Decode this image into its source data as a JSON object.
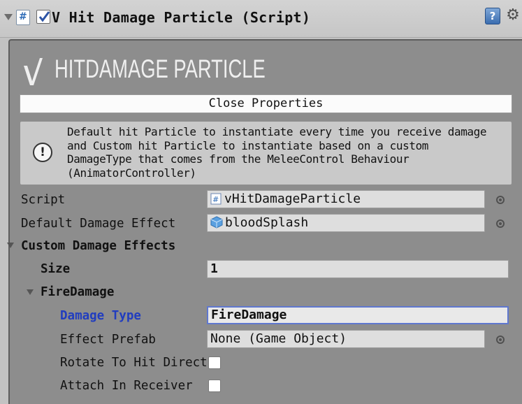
{
  "header": {
    "title": "V Hit Damage Particle (Script)",
    "enabled": true,
    "help_glyph": "?",
    "settings_glyph": "⚙"
  },
  "banner": {
    "logo_glyph": "V",
    "title": "HITDAMAGE PARTICLE",
    "close_label": "Close Properties"
  },
  "help": {
    "icon_glyph": "!",
    "text": "Default hit Particle to instantiate every time you receive damage\nand Custom hit Particle to instantiate based on a custom\nDamageType that comes from the MeleeControl Behaviour\n(AnimatorController)"
  },
  "fields": {
    "script": {
      "label": "Script",
      "value": "vHitDamageParticle"
    },
    "default_effect": {
      "label": "Default Damage Effect",
      "value": "bloodSplash"
    },
    "custom_effects": {
      "label": "Custom Damage Effects"
    },
    "size": {
      "label": "Size",
      "value": "1"
    },
    "element0": {
      "label": "FireDamage"
    },
    "damage_type": {
      "label": "Damage Type",
      "value": "FireDamage"
    },
    "effect_prefab": {
      "label": "Effect Prefab",
      "value": "None (Game Object)"
    },
    "rotate": {
      "label": "Rotate To Hit Direct",
      "checked": false
    },
    "attach": {
      "label": "Attach In Receiver",
      "checked": false
    }
  },
  "colors": {
    "panel": "#8d8d8d",
    "background": "#c2c2c2",
    "focus_blue": "#213dbf"
  }
}
